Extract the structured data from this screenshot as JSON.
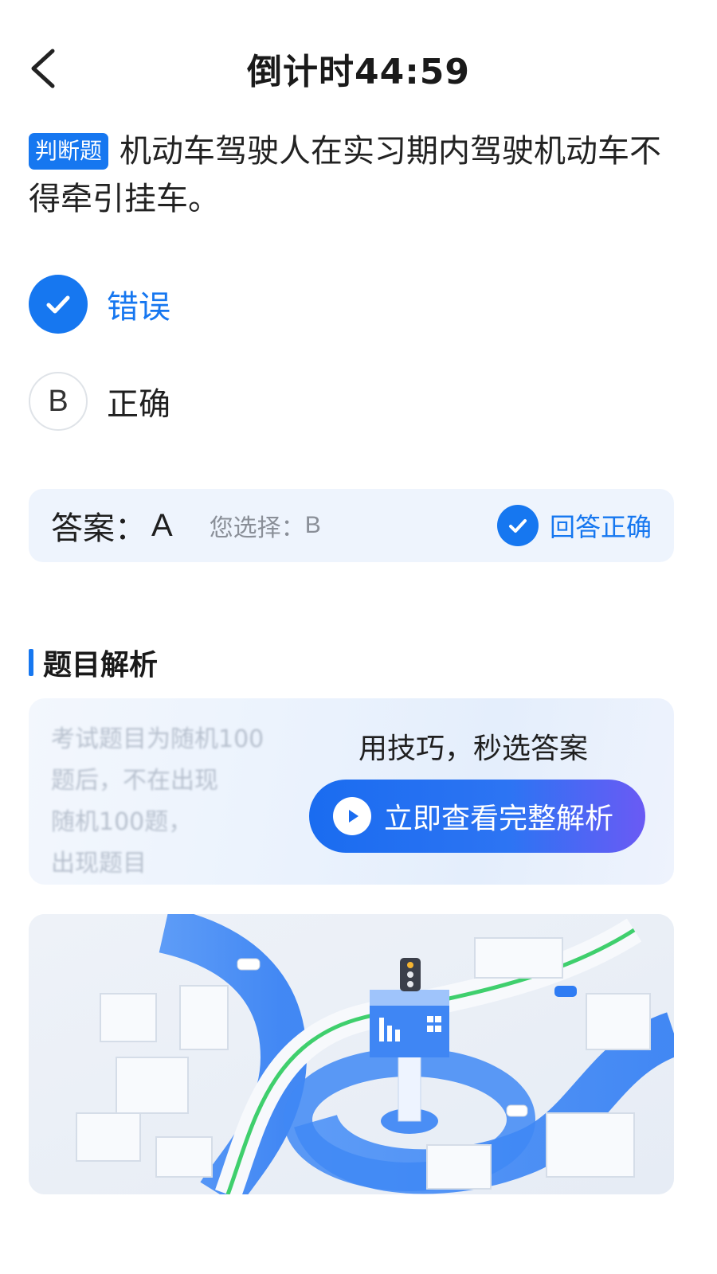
{
  "header": {
    "title": "倒计时44:59"
  },
  "question": {
    "type_badge": "判断题",
    "text": "机动车驾驶人在实习期内驾驶机动车不得牵引挂车。"
  },
  "options": [
    {
      "marker": "A",
      "label": "错误",
      "selected": true
    },
    {
      "marker": "B",
      "label": "正确",
      "selected": false
    }
  ],
  "answer": {
    "label": "答案：",
    "value": "A",
    "chosen_label": "您选择：",
    "chosen_value": "B",
    "status": "回答正确"
  },
  "analysis": {
    "section_title": "题目解析",
    "blurred_lines": [
      "考试题目为随机100",
      "题后，不在出现",
      "随机100题，",
      "出现题目"
    ],
    "hint": "用技巧，秒选答案",
    "button_label": "立即查看完整解析"
  },
  "colors": {
    "accent": "#1677f0",
    "answer_bg": "#eef4fd",
    "road_blue": "#3b86f5",
    "route_green": "#39c86a"
  }
}
